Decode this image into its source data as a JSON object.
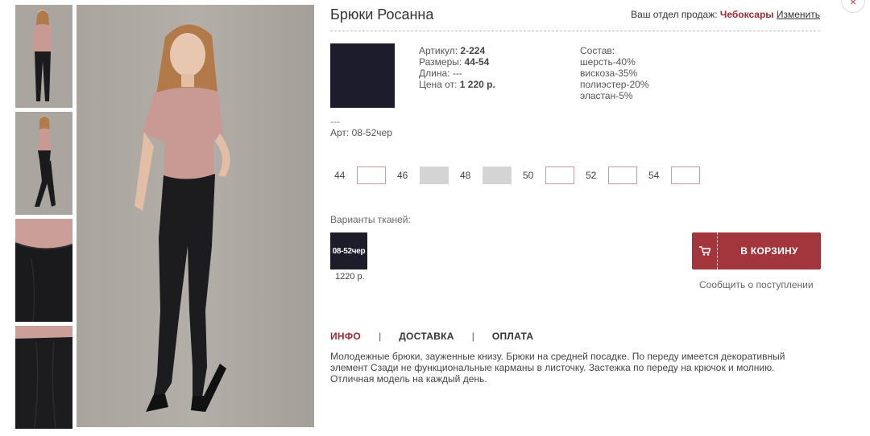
{
  "product": {
    "title": "Брюки Росанна",
    "article_label": "Артикул:",
    "article_value": "2-224",
    "sizes_label": "Размеры:",
    "sizes_value": "44-54",
    "length_label": "Длина:",
    "length_value": "---",
    "price_label": "Цена от:",
    "price_value": "1 220 р.",
    "composition_label": "Состав:",
    "composition": [
      "шерсть-40%",
      "вискоза-35%",
      "полиэстер-20%",
      "эластан-5%"
    ],
    "dash_text": "---",
    "art_text": "Арт: 08-52чер"
  },
  "region": {
    "label": "Ваш отдел продаж:",
    "city": "Чебоксары",
    "change_link": "Изменить"
  },
  "sizes": [
    {
      "label": "44",
      "available": true
    },
    {
      "label": "46",
      "available": false
    },
    {
      "label": "48",
      "available": false
    },
    {
      "label": "50",
      "available": true
    },
    {
      "label": "52",
      "available": true
    },
    {
      "label": "54",
      "available": true
    }
  ],
  "fabrics": {
    "label": "Варианты тканей:",
    "items": [
      {
        "code": "08-52чер",
        "price": "1220 р.",
        "color": "#1c1c2b"
      }
    ]
  },
  "cart": {
    "button_label": "В КОРЗИНУ",
    "notify_label": "Сообщить о поступлении",
    "icon": "cart-icon"
  },
  "tabs": [
    {
      "label": "ИНФО",
      "active": true
    },
    {
      "label": "ДОСТАВКА",
      "active": false
    },
    {
      "label": "ОПЛАТА",
      "active": false
    }
  ],
  "description": "Молодежные брюки, зауженные книзу. Брюки на средней посадке. По переду имеется декоративный элемент Сзади не функциональные карманы в листочку. Застежка по переду на крючок и молнию. Отличная модель на каждый день.",
  "colors": {
    "accent": "#9b2a32",
    "button": "#a3363d",
    "fabric_swatch": "#1c1c2b",
    "photo_background": "#a9a49e",
    "top_color": "#c99a94"
  },
  "close": {
    "icon": "close-icon",
    "glyph": "×"
  }
}
